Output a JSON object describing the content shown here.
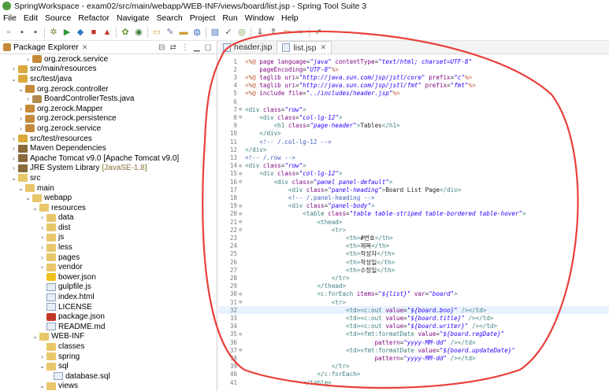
{
  "window": {
    "title": "SpringWorkspace - exam02/src/main/webapp/WEB-INF/views/board/list.jsp - Spring Tool Suite 3"
  },
  "menu": [
    "File",
    "Edit",
    "Source",
    "Refactor",
    "Navigate",
    "Search",
    "Project",
    "Run",
    "Window",
    "Help"
  ],
  "toolbar": {
    "icons": [
      "new-icon",
      "save-icon",
      "save-all-icon",
      "debug-icon",
      "run-icon",
      "run-ext-icon",
      "stop-icon",
      "server-icon",
      "boot-icon",
      "gear-icon",
      "open-type-icon",
      "task-icon",
      "folder-icon",
      "search-icon",
      "nav-icon",
      "annotation-icon",
      "next-annotation-icon",
      "back-icon",
      "forward-icon",
      "perspective-icon"
    ]
  },
  "package_explorer": {
    "title": "Package Explorer",
    "tree": [
      {
        "depth": 3,
        "arrow": ">",
        "icon": "package-icon",
        "label": "org.zerock.service",
        "suffix": ""
      },
      {
        "depth": 1,
        "arrow": ">",
        "icon": "source-folder-icon",
        "label": "src/main/resources",
        "suffix": ""
      },
      {
        "depth": 1,
        "arrow": "v",
        "icon": "source-folder-icon",
        "label": "src/test/java",
        "suffix": ""
      },
      {
        "depth": 2,
        "arrow": "v",
        "icon": "package-icon",
        "label": "org.zerock.controller",
        "suffix": ""
      },
      {
        "depth": 3,
        "arrow": ">",
        "icon": "java-file-icon",
        "label": "BoardControllerTests.java",
        "suffix": ""
      },
      {
        "depth": 2,
        "arrow": ">",
        "icon": "package-icon",
        "label": "org.zerock.Mapper",
        "suffix": ""
      },
      {
        "depth": 2,
        "arrow": ">",
        "icon": "package-icon",
        "label": "org.zerock.persistence",
        "suffix": ""
      },
      {
        "depth": 2,
        "arrow": ">",
        "icon": "package-icon",
        "label": "org.zerock.service",
        "suffix": ""
      },
      {
        "depth": 1,
        "arrow": ">",
        "icon": "source-folder-icon",
        "label": "src/test/resources",
        "suffix": ""
      },
      {
        "depth": 1,
        "arrow": ">",
        "icon": "library-icon",
        "label": "Maven Dependencies",
        "suffix": ""
      },
      {
        "depth": 1,
        "arrow": ">",
        "icon": "library-icon",
        "label": "Apache Tomcat v9.0 [Apache Tomcat v9.0]",
        "suffix": ""
      },
      {
        "depth": 1,
        "arrow": ">",
        "icon": "library-icon",
        "label": "JRE System Library",
        "suffix": "[JavaSE-1.8]"
      },
      {
        "depth": 1,
        "arrow": "v",
        "icon": "folder-icon",
        "label": "src",
        "suffix": ""
      },
      {
        "depth": 2,
        "arrow": "v",
        "icon": "folder-icon",
        "label": "main",
        "suffix": ""
      },
      {
        "depth": 3,
        "arrow": "v",
        "icon": "folder-icon",
        "label": "webapp",
        "suffix": ""
      },
      {
        "depth": 4,
        "arrow": "v",
        "icon": "folder-icon",
        "label": "resources",
        "suffix": ""
      },
      {
        "depth": 5,
        "arrow": ">",
        "icon": "folder-icon",
        "label": "data",
        "suffix": ""
      },
      {
        "depth": 5,
        "arrow": ">",
        "icon": "folder-icon",
        "label": "dist",
        "suffix": ""
      },
      {
        "depth": 5,
        "arrow": ">",
        "icon": "folder-icon",
        "label": "js",
        "suffix": ""
      },
      {
        "depth": 5,
        "arrow": ">",
        "icon": "folder-icon",
        "label": "less",
        "suffix": ""
      },
      {
        "depth": 5,
        "arrow": ">",
        "icon": "folder-icon",
        "label": "pages",
        "suffix": ""
      },
      {
        "depth": 5,
        "arrow": ">",
        "icon": "folder-icon",
        "label": "vendor",
        "suffix": ""
      },
      {
        "depth": 5,
        "arrow": "",
        "icon": "json-file-icon",
        "label": "bower.json",
        "suffix": ""
      },
      {
        "depth": 5,
        "arrow": "",
        "icon": "file-icon",
        "label": "gulpfile.js",
        "suffix": ""
      },
      {
        "depth": 5,
        "arrow": "",
        "icon": "file-icon",
        "label": "index.html",
        "suffix": ""
      },
      {
        "depth": 5,
        "arrow": "",
        "icon": "file-icon",
        "label": "LICENSE",
        "suffix": ""
      },
      {
        "depth": 5,
        "arrow": "",
        "icon": "package-json-icon",
        "label": "package.json",
        "suffix": ""
      },
      {
        "depth": 5,
        "arrow": "",
        "icon": "file-icon",
        "label": "README.md",
        "suffix": ""
      },
      {
        "depth": 4,
        "arrow": "v",
        "icon": "folder-icon",
        "label": "WEB-INF",
        "suffix": ""
      },
      {
        "depth": 5,
        "arrow": "",
        "icon": "folder-icon",
        "label": "classes",
        "suffix": ""
      },
      {
        "depth": 5,
        "arrow": ">",
        "icon": "folder-icon",
        "label": "spring",
        "suffix": ""
      },
      {
        "depth": 5,
        "arrow": "v",
        "icon": "folder-icon",
        "label": "sql",
        "suffix": ""
      },
      {
        "depth": 6,
        "arrow": "",
        "icon": "file-icon",
        "label": "database.sql",
        "suffix": ""
      },
      {
        "depth": 5,
        "arrow": "v",
        "icon": "folder-icon",
        "label": "views",
        "suffix": ""
      }
    ]
  },
  "editor": {
    "tabs": [
      {
        "label": "header.jsp",
        "active": false
      },
      {
        "label": "list.jsp",
        "active": true
      }
    ],
    "highlight_line": 32,
    "lines": [
      {
        "n": "1",
        "fold": "",
        "html": "<span class=\"dir\">&lt;%@</span> <span class=\"at\">page language</span>=<span class=\"st\">\"java\"</span> <span class=\"at\">contentType</span>=<span class=\"st\">\"text/html; charset=UTF-8\"</span>"
      },
      {
        "n": "2",
        "fold": "",
        "html": "    <span class=\"at\">pageEncoding</span>=<span class=\"st\">\"UTF-8\"</span><span class=\"dir\">%&gt;</span>"
      },
      {
        "n": "3",
        "fold": "",
        "html": "<span class=\"dir\">&lt;%@</span> <span class=\"at\">taglib uri</span>=<span class=\"st\">\"http://java.sun.com/jsp/jstl/core\"</span> <span class=\"at\">prefix</span>=<span class=\"st\">\"c\"</span><span class=\"dir\">%&gt;</span>"
      },
      {
        "n": "4",
        "fold": "",
        "html": "<span class=\"dir\">&lt;%@</span> <span class=\"at\">taglib uri</span>=<span class=\"st\">\"http://java.sun.com/jsp/jstl/fmt\"</span> <span class=\"at\">prefix</span>=<span class=\"st\">\"fmt\"</span><span class=\"dir\">%&gt;</span>"
      },
      {
        "n": "5",
        "fold": "",
        "html": "<span class=\"dir\">&lt;%@</span> <span class=\"at\">include file</span>=<span class=\"st\">\"../includes/header.jsp\"</span><span class=\"dir\">%&gt;</span>"
      },
      {
        "n": "6",
        "fold": "",
        "html": ""
      },
      {
        "n": "7",
        "fold": "⊖",
        "html": "<span class=\"kw\">&lt;div</span> <span class=\"at\">class</span>=<span class=\"st\">\"row\"</span><span class=\"kw\">&gt;</span>"
      },
      {
        "n": "8",
        "fold": "⊖",
        "html": "    <span class=\"kw\">&lt;div</span> <span class=\"at\">class</span>=<span class=\"st\">\"col-lg-12\"</span><span class=\"kw\">&gt;</span>"
      },
      {
        "n": "9",
        "fold": "",
        "html": "        <span class=\"kw\">&lt;h1</span> <span class=\"at\">class</span>=<span class=\"st\">\"page-header\"</span><span class=\"kw\">&gt;</span>Tables<span class=\"kw\">&lt;/h1&gt;</span>"
      },
      {
        "n": "10",
        "fold": "",
        "html": "    <span class=\"kw\">&lt;/div&gt;</span>"
      },
      {
        "n": "11",
        "fold": "",
        "html": "    <span class=\"cm\">&lt;!-- /.col-lg-12 --&gt;</span>"
      },
      {
        "n": "12",
        "fold": "",
        "html": "<span class=\"kw\">&lt;/div&gt;</span>"
      },
      {
        "n": "13",
        "fold": "",
        "html": "<span class=\"cm\">&lt;!-- /.row --&gt;</span>"
      },
      {
        "n": "14",
        "fold": "⊖",
        "html": "<span class=\"kw\">&lt;div</span> <span class=\"at\">class</span>=<span class=\"st\">\"row\"</span><span class=\"kw\">&gt;</span>"
      },
      {
        "n": "15",
        "fold": "⊖",
        "html": "    <span class=\"kw\">&lt;div</span> <span class=\"at\">class</span>=<span class=\"st\">\"col-lg-12\"</span><span class=\"kw\">&gt;</span>"
      },
      {
        "n": "16",
        "fold": "⊖",
        "html": "        <span class=\"kw\">&lt;div</span> <span class=\"at\">class</span>=<span class=\"st\">\"panel panel-default\"</span><span class=\"kw\">&gt;</span>"
      },
      {
        "n": "17",
        "fold": "",
        "html": "            <span class=\"kw\">&lt;div</span> <span class=\"at\">class</span>=<span class=\"st\">\"panel-heading\"</span><span class=\"kw\">&gt;</span>Board List Page<span class=\"kw\">&lt;/div&gt;</span>"
      },
      {
        "n": "18",
        "fold": "",
        "html": "            <span class=\"cm\">&lt;!-- /.panel-heading --&gt;</span>"
      },
      {
        "n": "19",
        "fold": "⊖",
        "html": "            <span class=\"kw\">&lt;div</span> <span class=\"at\">class</span>=<span class=\"st\">\"panel-body\"</span><span class=\"kw\">&gt;</span>"
      },
      {
        "n": "20",
        "fold": "⊖",
        "html": "                <span class=\"kw\">&lt;table</span> <span class=\"at\">class</span>=<span class=\"st\">\"table table-striped table-bordered table-hover\"</span><span class=\"kw\">&gt;</span>"
      },
      {
        "n": "21",
        "fold": "⊖",
        "html": "                    <span class=\"kw\">&lt;thead&gt;</span>"
      },
      {
        "n": "22",
        "fold": "⊖",
        "html": "                        <span class=\"kw\">&lt;tr&gt;</span>"
      },
      {
        "n": "23",
        "fold": "",
        "html": "                            <span class=\"kw\">&lt;th&gt;</span>#번호<span class=\"kw\">&lt;/th&gt;</span>"
      },
      {
        "n": "24",
        "fold": "",
        "html": "                            <span class=\"kw\">&lt;th&gt;</span>제목<span class=\"kw\">&lt;/th&gt;</span>"
      },
      {
        "n": "25",
        "fold": "",
        "html": "                            <span class=\"kw\">&lt;th&gt;</span>작성자<span class=\"kw\">&lt;/th&gt;</span>"
      },
      {
        "n": "26",
        "fold": "",
        "html": "                            <span class=\"kw\">&lt;th&gt;</span>작성일<span class=\"kw\">&lt;/th&gt;</span>"
      },
      {
        "n": "27",
        "fold": "",
        "html": "                            <span class=\"kw\">&lt;th&gt;</span>수정일<span class=\"kw\">&lt;/th&gt;</span>"
      },
      {
        "n": "28",
        "fold": "",
        "html": "                        <span class=\"kw\">&lt;/tr&gt;</span>"
      },
      {
        "n": "29",
        "fold": "",
        "html": "                    <span class=\"kw\">&lt;/thead&gt;</span>"
      },
      {
        "n": "30",
        "fold": "⊖",
        "html": "                    <span class=\"kw\">&lt;c:forEach</span> <span class=\"at\">items</span>=<span class=\"st\">\"${list}\"</span> <span class=\"at\">var</span>=<span class=\"st\">\"board\"</span><span class=\"kw\">&gt;</span>"
      },
      {
        "n": "31",
        "fold": "⊖",
        "html": "                        <span class=\"kw\">&lt;tr&gt;</span>"
      },
      {
        "n": "32",
        "fold": "",
        "html": "                            <span class=\"kw\">&lt;td&gt;&lt;c:out</span> <span class=\"at\">value</span>=<span class=\"st\">\"${board.bno}\"</span> <span class=\"kw\">/&gt;&lt;/td&gt;</span>"
      },
      {
        "n": "33",
        "fold": "",
        "html": "                            <span class=\"kw\">&lt;td&gt;&lt;c:out</span> <span class=\"at\">value</span>=<span class=\"st\">\"${board.title}\"</span> <span class=\"kw\">/&gt;&lt;/td&gt;</span>"
      },
      {
        "n": "34",
        "fold": "",
        "html": "                            <span class=\"kw\">&lt;td&gt;&lt;c:out</span> <span class=\"at\">value</span>=<span class=\"st\">\"${board.writer}\"</span> <span class=\"kw\">/&gt;&lt;/td&gt;</span>"
      },
      {
        "n": "35",
        "fold": "⊖",
        "html": "                            <span class=\"kw\">&lt;td&gt;&lt;fmt:formatDate</span> <span class=\"at\">value</span>=<span class=\"st\">\"${board.regDate}\"</span>"
      },
      {
        "n": "36",
        "fold": "",
        "html": "                                    <span class=\"at\">pattern</span>=<span class=\"st\">\"yyyy-MM-dd\"</span> <span class=\"kw\">/&gt;&lt;/td&gt;</span>"
      },
      {
        "n": "37",
        "fold": "⊖",
        "html": "                            <span class=\"kw\">&lt;td&gt;&lt;fmt:formatDate</span> <span class=\"at\">value</span>=<span class=\"st\">\"${board.updateDate}\"</span>"
      },
      {
        "n": "38",
        "fold": "",
        "html": "                                    <span class=\"at\">pattern</span>=<span class=\"st\">\"yyyy-MM-dd\"</span> <span class=\"kw\">/&gt;&lt;/td&gt;</span>"
      },
      {
        "n": "39",
        "fold": "",
        "html": "                        <span class=\"kw\">&lt;/tr&gt;</span>"
      },
      {
        "n": "40",
        "fold": "",
        "html": "                    <span class=\"kw\">&lt;/c:forEach&gt;</span>"
      },
      {
        "n": "41",
        "fold": "",
        "html": "                <span class=\"kw\">&lt;/table&gt;</span>"
      }
    ]
  },
  "annotation": {
    "color": "#e8403a",
    "shape": "hand-drawn-ellipse"
  }
}
